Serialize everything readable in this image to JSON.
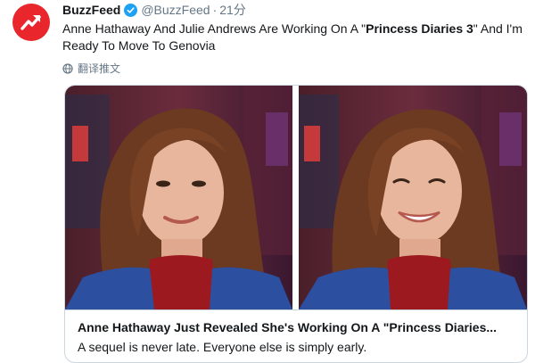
{
  "account": {
    "name": "BuzzFeed",
    "handle": "@BuzzFeed",
    "separator": "·",
    "time": "21分",
    "verified": true,
    "avatar_color": "#e8262b",
    "avatar_icon": "trending-arrow-icon"
  },
  "tweet": {
    "text_before": "Anne Hathaway And Julie Andrews Are Working On A \"",
    "text_bold": "Princess Diaries 3",
    "text_after": "\" And I'm Ready To Move To Genovia"
  },
  "translate": {
    "icon": "globe-icon",
    "label": "翻译推文"
  },
  "card": {
    "title": "Anne Hathaway Just Revealed She's Working On A \"Princess Diaries...",
    "description": "A sequel is never late. Everyone else is simply early.",
    "images": [
      {
        "alt": "Anne Hathaway smiling in red turtleneck and blue blazer"
      },
      {
        "alt": "Anne Hathaway smiling widely in red turtleneck and blue blazer"
      }
    ]
  },
  "colors": {
    "accent_blue": "#1da1f2",
    "secondary_text": "#657786",
    "border": "#ccd6dd"
  }
}
